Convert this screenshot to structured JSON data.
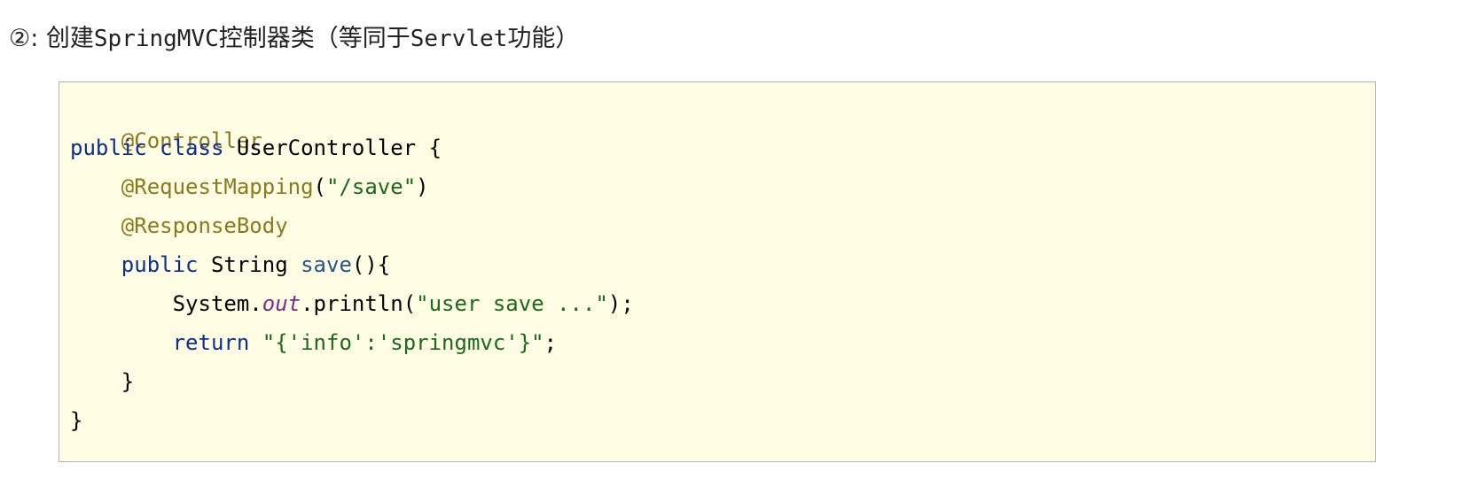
{
  "heading": {
    "prefix": "②: ",
    "part1": "创建",
    "part2": "SpringMVC",
    "part3": "控制器类（等同于",
    "part4": "Servlet",
    "part5": "功能）"
  },
  "code": {
    "l1_ann": "@Controller",
    "l2_kw1": "public",
    "l2_kw2": "class",
    "l2_rest": "UserController {",
    "l3_ann": "@RequestMapping",
    "l3_p1": "(",
    "l3_str": "\"/save\"",
    "l3_p2": ")",
    "l4_ann": "@ResponseBody",
    "l5_kw": "public",
    "l5_type": "String",
    "l5_fn": "save",
    "l5_rest": "(){",
    "l6_obj": "System.",
    "l6_field": "out",
    "l6_call": ".println(",
    "l6_str": "\"user save ...\"",
    "l6_end": ");",
    "l7_kw": "return",
    "l7_str": "\"{'info':'springmvc'}\"",
    "l7_end": ";",
    "l8_brace": "}",
    "l9_brace": "}"
  }
}
